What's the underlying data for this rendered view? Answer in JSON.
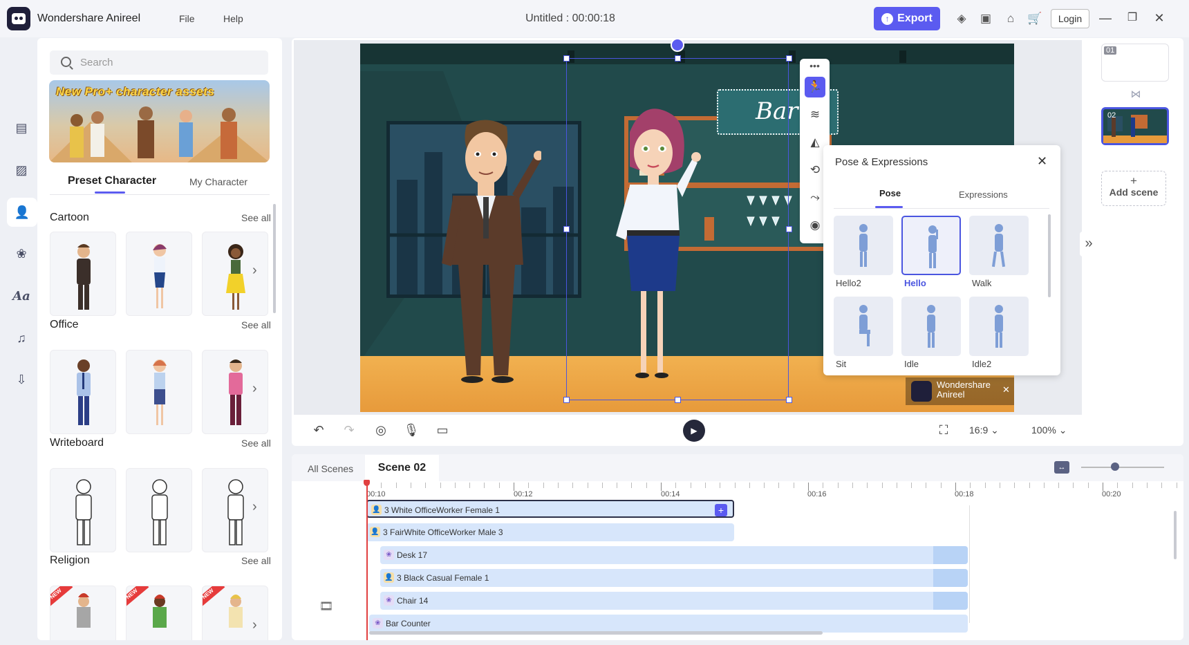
{
  "app": {
    "name": "Wondershare Anireel",
    "doc_title": "Untitled : 00:00:18"
  },
  "menu": {
    "file": "File",
    "help": "Help"
  },
  "header": {
    "export_label": "Export",
    "login_label": "Login"
  },
  "left_panel": {
    "search_placeholder": "Search",
    "banner_text": "New Pro+ character assets",
    "tabs": [
      "Preset Character",
      "My Character"
    ],
    "see_all": "See all",
    "sections": [
      {
        "title": "Cartoon"
      },
      {
        "title": "Office"
      },
      {
        "title": "Writeboard"
      },
      {
        "title": "Religion"
      }
    ],
    "new_tag": "NEW"
  },
  "canvas": {
    "bar_sign": "Bar",
    "watermark_line1": "Wondershare",
    "watermark_line2": "Anireel"
  },
  "pose_panel": {
    "title": "Pose & Expressions",
    "tabs": [
      "Pose",
      "Expressions"
    ],
    "poses": [
      "Hello2",
      "Hello",
      "Walk",
      "Sit",
      "Idle",
      "Idle2"
    ],
    "selected": "Hello"
  },
  "scenes": {
    "items": [
      {
        "number": "01"
      },
      {
        "number": "02"
      }
    ],
    "add_label": "Add scene"
  },
  "canvas_bar": {
    "aspect": "16:9",
    "zoom": "100%"
  },
  "timeline": {
    "tab_all": "All Scenes",
    "tab_scene": "Scene 02",
    "ticks": [
      "00:10",
      "00:12",
      "00:14",
      "00:16",
      "00:18",
      "00:20"
    ],
    "tracks": [
      {
        "label": "3 White OfficeWorker Female 1",
        "type": "character"
      },
      {
        "label": "3 FairWhite OfficeWorker Male 3",
        "type": "character"
      },
      {
        "label": "Desk 17",
        "type": "prop"
      },
      {
        "label": "3 Black Casual Female 1",
        "type": "character"
      },
      {
        "label": "Chair 14",
        "type": "prop"
      },
      {
        "label": "Bar Counter",
        "type": "prop"
      }
    ]
  }
}
